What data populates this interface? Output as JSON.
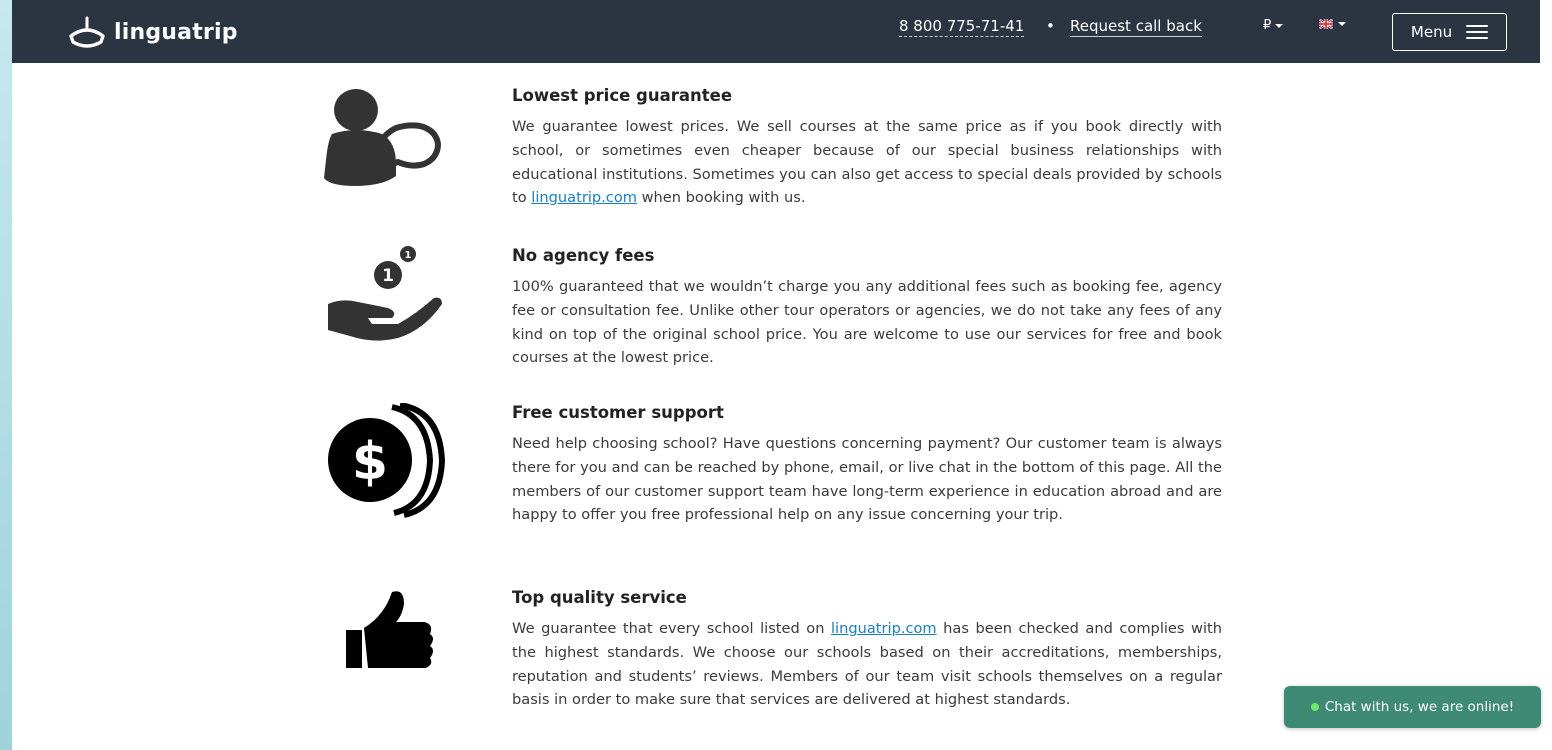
{
  "header": {
    "logo_text": "linguatrip",
    "phone": "8 800 775-71-41",
    "separator": "•",
    "callback_label": "Request call back",
    "currency_symbol": "₽",
    "menu_label": "Menu"
  },
  "features": [
    {
      "icon": "person-speech-bubble-icon",
      "title": "Lowest price guarantee",
      "text_before_link": "We guarantee lowest prices. We sell courses at the same price as if you book directly with school, or sometimes even cheaper because of our special business relationships with educational institutions. Sometimes you can also get access to special deals provided by schools to ",
      "link": "linguatrip.com",
      "text_after_link": " when booking with us."
    },
    {
      "icon": "hand-coins-icon",
      "title": "No agency fees",
      "text": "100% guaranteed that we wouldn’t charge you any additional fees such as booking fee, agency fee or consultation fee. Unlike other tour operators or agencies, we do not take any fees of any kind on top of the original school price. You are welcome to use our services for free and book courses at the lowest price."
    },
    {
      "icon": "dollar-coin-icon",
      "title": "Free customer support",
      "text": "Need help choosing school? Have questions concerning payment? Our customer team is always there for you and can be reached by phone, email, or live chat in the bottom of this page. All the members of our customer support team have long-term experience in education abroad and are happy to offer you free professional help on any issue concerning your trip."
    },
    {
      "icon": "thumbs-up-icon",
      "title": "Top quality service",
      "text_before_link": "We guarantee that every school listed on ",
      "link": "linguatrip.com",
      "text_after_link": " has been checked and complies with the highest standards. We choose our schools based on their accreditations, memberships, reputation and students’ reviews. Members of our team visit schools themselves on a regular basis in order to make sure that services are delivered at highest standards."
    }
  ],
  "chat": {
    "label": "Chat with us, we are online!",
    "status_color": "#6ee66e"
  },
  "colors": {
    "header_bg": "#2b3542",
    "link": "#1a7fbf",
    "chat_bg": "#3f8a75"
  }
}
